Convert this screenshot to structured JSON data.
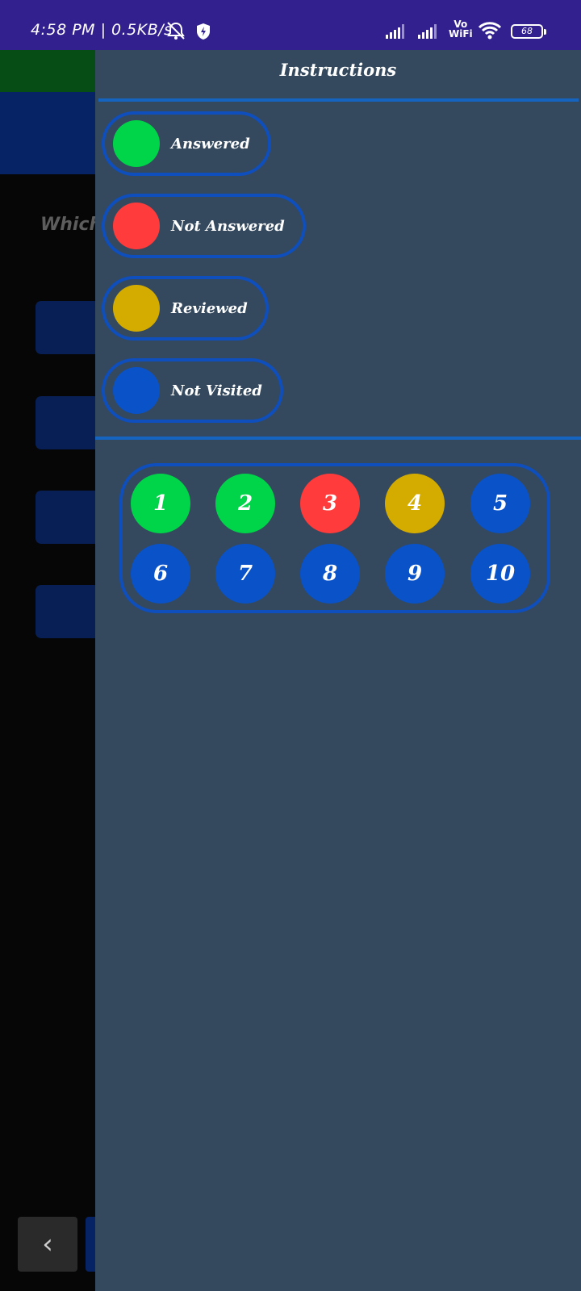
{
  "status_bar": {
    "time_speed": "4:58 PM | 0.5KB/s",
    "vowifi_line1": "Vo",
    "vowifi_line2": "WiFi",
    "battery": "68"
  },
  "background": {
    "question_text": "Which"
  },
  "drawer": {
    "title": "Instructions",
    "legend": [
      {
        "label": "Answered",
        "color": "#00d448"
      },
      {
        "label": "Not Answered",
        "color": "#ff3b3b"
      },
      {
        "label": "Reviewed",
        "color": "#d4ac00"
      },
      {
        "label": "Not Visited",
        "color": "#0a52c8"
      }
    ],
    "questions": [
      {
        "number": "1",
        "status": "Answered"
      },
      {
        "number": "2",
        "status": "Answered"
      },
      {
        "number": "3",
        "status": "Not Answered"
      },
      {
        "number": "4",
        "status": "Reviewed"
      },
      {
        "number": "5",
        "status": "Not Visited"
      },
      {
        "number": "6",
        "status": "Not Visited"
      },
      {
        "number": "7",
        "status": "Not Visited"
      },
      {
        "number": "8",
        "status": "Not Visited"
      },
      {
        "number": "9",
        "status": "Not Visited"
      },
      {
        "number": "10",
        "status": "Not Visited"
      }
    ]
  },
  "colors": {
    "status_bar": "#33208f",
    "drawer": "#34495e",
    "accent_blue": "#1565c0"
  }
}
